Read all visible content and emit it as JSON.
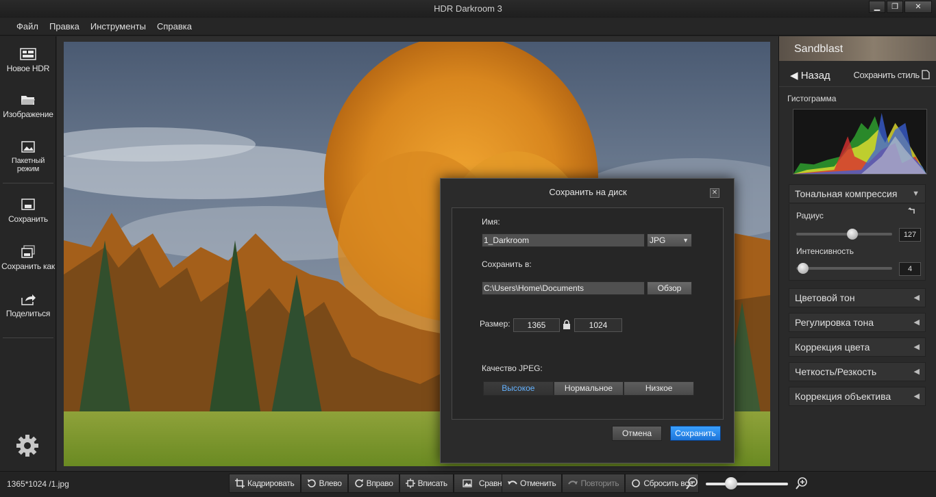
{
  "window": {
    "title": "HDR Darkroom 3",
    "minimize": "▁",
    "maximize": "❐",
    "close": "✕"
  },
  "menu": [
    "Файл",
    "Правка",
    "Инструменты",
    "Справка"
  ],
  "left_toolbar": {
    "new_hdr": "Новое HDR",
    "image": "Изображение",
    "batch": "Пакетный режим",
    "save": "Сохранить",
    "save_as": "Сохранить как",
    "share": "Поделиться"
  },
  "right_panel": {
    "style_name": "Sandblast",
    "back": "◀ Назад",
    "save_style": "Сохранить стиль",
    "histogram_title": "Гистограмма",
    "tone_compression": "Тональная компрессия",
    "radius_label": "Радиус",
    "radius_value": "127",
    "radius_fraction": 0.6,
    "intensity_label": "Интенсивность",
    "intensity_value": "4",
    "intensity_fraction": 0.02,
    "sections": [
      "Цветовой тон",
      "Регулировка тона",
      "Коррекция цвета",
      "Четкость/Резкость",
      "Коррекция объектива"
    ],
    "expanded_arrow": "▼",
    "collapsed_arrow": "◀"
  },
  "dialog": {
    "title": "Сохранить на диск",
    "close": "✕",
    "name_label": "Имя:",
    "name_value": "1_Darkroom",
    "format": "JPG",
    "save_in_label": "Сохранить в:",
    "path_value": "C:\\Users\\Home\\Documents",
    "browse": "Обзор",
    "size_label": "Размер:",
    "width": "1365",
    "height": "1024",
    "quality_label": "Качество JPEG:",
    "quality_options": [
      "Высокое",
      "Нормальное",
      "Низкое"
    ],
    "quality_selected": "Высокое",
    "cancel": "Отмена",
    "save": "Сохранить"
  },
  "bottom": {
    "status": "1365*1024 /1.jpg",
    "crop": "Кадрировать",
    "rotate_left": "Влево",
    "rotate_right": "Вправо",
    "fit": "Вписать",
    "compare": "Сравнить",
    "undo": "Отменить",
    "redo": "Повторить",
    "reset_all": "Сбросить все",
    "zoom_fraction": 0.27
  },
  "colors": {
    "accent": "#2a8cf0",
    "selected_quality_text": "#64b2ff"
  }
}
